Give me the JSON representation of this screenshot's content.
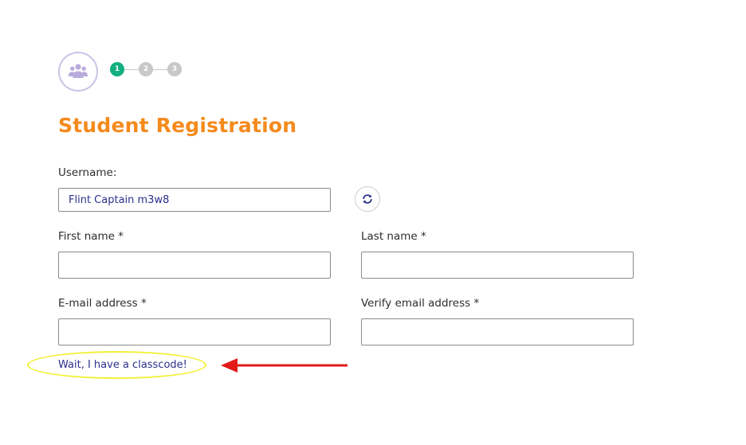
{
  "header": {
    "avatar_icon": "users-group-icon",
    "steps": [
      "1",
      "2",
      "3"
    ],
    "active_step": 1,
    "colors": {
      "active_step": "#11b07e",
      "inactive_step": "#c8c8c8",
      "avatar_border": "#c9c3e6",
      "avatar_icon": "#b9acdc"
    }
  },
  "title": "Student Registration",
  "title_color": "#f48a1c",
  "form": {
    "username": {
      "label": "Username:",
      "value": "Flint Captain m3w8",
      "refresh_icon": "refresh-icon"
    },
    "first_name": {
      "label": "First name *",
      "value": ""
    },
    "last_name": {
      "label": "Last name *",
      "value": ""
    },
    "email": {
      "label": "E-mail address *",
      "value": ""
    },
    "verify_email": {
      "label": "Verify email address *",
      "value": ""
    }
  },
  "classcode_link": "Wait, I have a classcode!",
  "annotation": {
    "highlight_color": "#f3f036",
    "arrow_color": "#e31b1b"
  }
}
